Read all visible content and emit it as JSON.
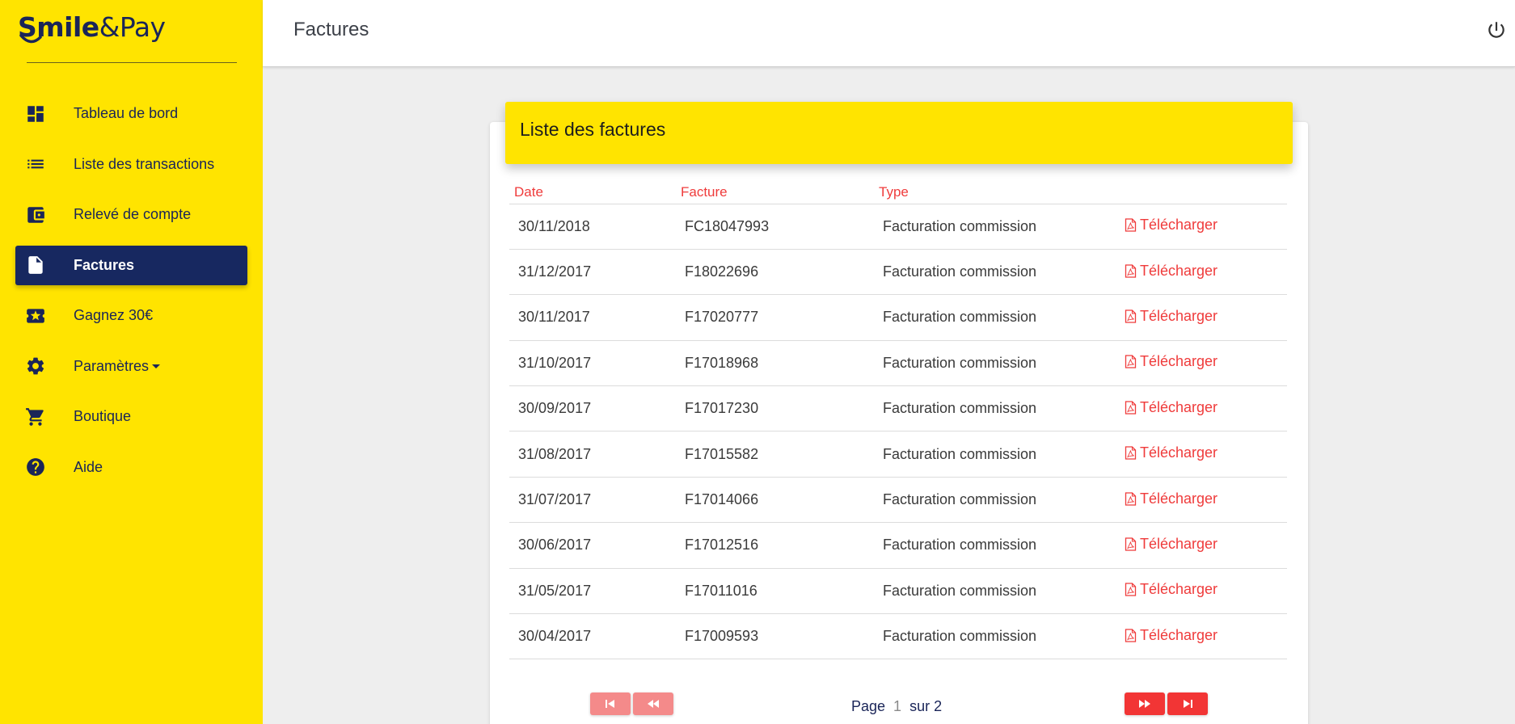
{
  "app": {
    "logo_bold": "Smile",
    "logo_rest": "&Pay"
  },
  "header": {
    "title": "Factures"
  },
  "sidebar": {
    "items": [
      {
        "label": "Tableau de bord",
        "icon": "dashboard-icon"
      },
      {
        "label": "Liste des transactions",
        "icon": "list-icon"
      },
      {
        "label": "Relevé de compte",
        "icon": "wallet-icon"
      },
      {
        "label": "Factures",
        "icon": "document-icon",
        "active": true
      },
      {
        "label": "Gagnez 30€",
        "icon": "ticket-star-icon"
      },
      {
        "label": "Paramètres",
        "icon": "gear-icon",
        "has_dropdown": true
      },
      {
        "label": "Boutique",
        "icon": "cart-icon"
      },
      {
        "label": "Aide",
        "icon": "help-icon"
      }
    ]
  },
  "card": {
    "title": "Liste des factures",
    "columns": [
      "Date",
      "Facture",
      "Type",
      ""
    ],
    "download_label": "Télécharger",
    "rows": [
      {
        "date": "30/11/2018",
        "invoice": "FC18047993",
        "type": "Facturation commission"
      },
      {
        "date": "31/12/2017",
        "invoice": "F18022696",
        "type": "Facturation commission"
      },
      {
        "date": "30/11/2017",
        "invoice": "F17020777",
        "type": "Facturation commission"
      },
      {
        "date": "31/10/2017",
        "invoice": "F17018968",
        "type": "Facturation commission"
      },
      {
        "date": "30/09/2017",
        "invoice": "F17017230",
        "type": "Facturation commission"
      },
      {
        "date": "31/08/2017",
        "invoice": "F17015582",
        "type": "Facturation commission"
      },
      {
        "date": "31/07/2017",
        "invoice": "F17014066",
        "type": "Facturation commission"
      },
      {
        "date": "30/06/2017",
        "invoice": "F17012516",
        "type": "Facturation commission"
      },
      {
        "date": "31/05/2017",
        "invoice": "F17011016",
        "type": "Facturation commission"
      },
      {
        "date": "30/04/2017",
        "invoice": "F17009593",
        "type": "Facturation commission"
      }
    ]
  },
  "pagination": {
    "page_label": "Page",
    "current_page": "1",
    "total_label": "sur 2"
  },
  "colors": {
    "brand_yellow": "#ffe400",
    "brand_navy": "#172860",
    "accent_red": "#ef3b3b"
  }
}
